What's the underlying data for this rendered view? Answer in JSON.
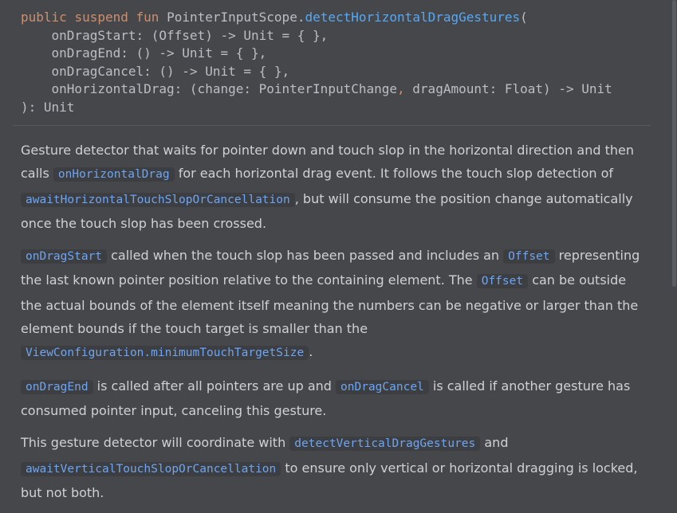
{
  "signature": {
    "kw_public": "public",
    "kw_suspend": "suspend",
    "kw_fun": "fun",
    "receiver": "PointerInputScope.",
    "fn_name": "detectHorizontalDragGestures",
    "open_paren": "(",
    "line2": "    onDragStart: (Offset) -> Unit = { },",
    "line3": "    onDragEnd: () -> Unit = { },",
    "line4": "    onDragCancel: () -> Unit = { },",
    "line5a": "    onHorizontalDrag: (change: PointerInputChange",
    "line5comma": ",",
    "line5b": " dragAmount: Float) -> Unit",
    "line6": "): Unit"
  },
  "doc": {
    "p1": {
      "t1": "Gesture detector that waits for pointer down and touch slop in the horizontal direction and then calls ",
      "r1": "onHorizontalDrag",
      "t2": " for each horizontal drag event. It follows the touch slop detection of ",
      "r2": "awaitHorizontalTouchSlopOrCancellation",
      "t3": ", but will consume the position change automatically once the touch slop has been crossed."
    },
    "p2": {
      "r1": "onDragStart",
      "t1": " called when the touch slop has been passed and includes an ",
      "r2": "Offset",
      "t2": " representing the last known pointer position relative to the containing element. The ",
      "r3": "Offset",
      "t3": " can be outside the actual bounds of the element itself meaning the numbers can be negative or larger than the element bounds if the touch target is smaller than the ",
      "r4": "ViewConfiguration.minimumTouchTargetSize",
      "t4": "."
    },
    "p3": {
      "r1": "onDragEnd",
      "t1": " is called after all pointers are up and ",
      "r2": "onDragCancel",
      "t2": " is called if another gesture has consumed pointer input, canceling this gesture."
    },
    "p4": {
      "t1": "This gesture detector will coordinate with ",
      "r1": "detectVerticalDragGestures",
      "t2": " and ",
      "r2": "awaitVerticalTouchSlopOrCancellation",
      "t3": " to ensure only vertical or horizontal dragging is locked, but not both."
    }
  }
}
